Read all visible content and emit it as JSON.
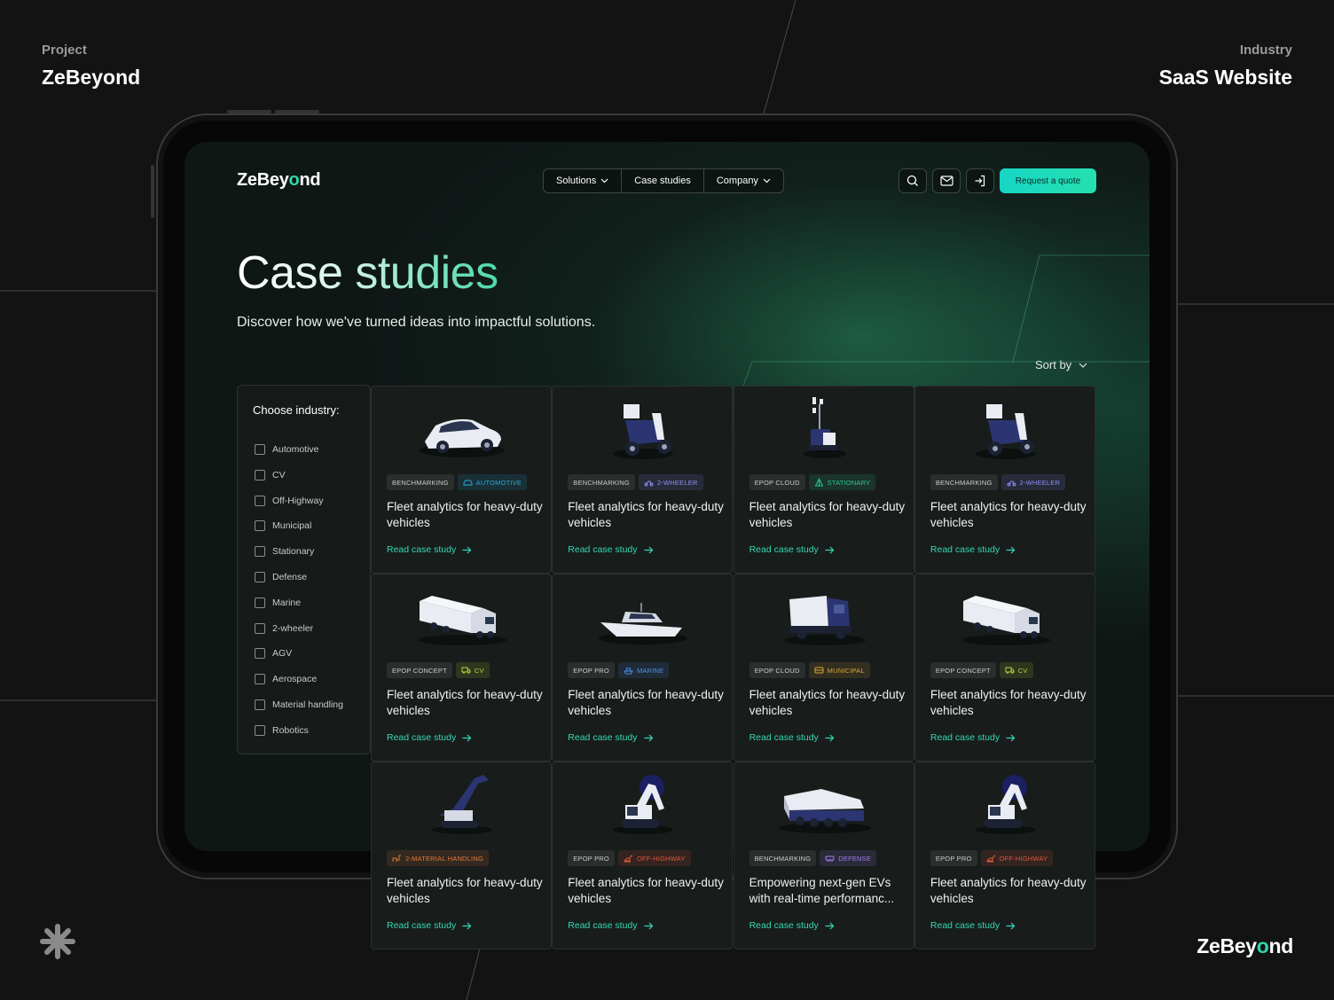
{
  "presentation": {
    "project_label": "Project",
    "project_name": "ZeBeyond",
    "industry_label": "Industry",
    "industry_name": "SaaS Website",
    "footer_logo_prefix": "ZeBey",
    "footer_logo_o": "o",
    "footer_logo_suffix": "nd"
  },
  "header": {
    "logo_prefix": "ZeBey",
    "logo_o": "o",
    "logo_suffix": "nd",
    "nav": [
      {
        "label": "Solutions",
        "dropdown": true
      },
      {
        "label": "Case studies",
        "dropdown": false
      },
      {
        "label": "Company",
        "dropdown": true
      }
    ],
    "icons": [
      "search-icon",
      "mail-icon",
      "login-icon"
    ],
    "cta_label": "Request a quote",
    "accent": "#1fdcc0"
  },
  "hero": {
    "title": "Case studies",
    "subtitle": "Discover how we've turned ideas into impactful solutions."
  },
  "sort": {
    "label": "Sort by"
  },
  "filters": {
    "title": "Choose industry:",
    "options": [
      "Automotive",
      "CV",
      "Off-Highway",
      "Municipal",
      "Stationary",
      "Defense",
      "Marine",
      "2-wheeler",
      "AGV",
      "Aerospace",
      "Material handling",
      "Robotics"
    ]
  },
  "cards": [
    {
      "image": "car",
      "tags": [
        {
          "label": "Benchmarking",
          "kind": "main"
        },
        {
          "label": "Automotive",
          "kind": "automotive",
          "color": "#2aa8d8"
        }
      ],
      "title": "Fleet analytics for heavy-duty vehicles",
      "link": "Read case study"
    },
    {
      "image": "scooter",
      "tags": [
        {
          "label": "Benchmarking",
          "kind": "main"
        },
        {
          "label": "2-wheeler",
          "kind": "twowheeler",
          "color": "#8d8ff0"
        }
      ],
      "title": "Fleet analytics for heavy-duty vehicles",
      "link": "Read case study"
    },
    {
      "image": "stationary",
      "tags": [
        {
          "label": "EPOP Cloud",
          "kind": "main"
        },
        {
          "label": "Stationary",
          "kind": "stationary",
          "color": "#2fc98c"
        }
      ],
      "title": "Fleet analytics for heavy-duty vehicles",
      "link": "Read case study"
    },
    {
      "image": "scooter",
      "tags": [
        {
          "label": "Benchmarking",
          "kind": "main"
        },
        {
          "label": "2-wheeler",
          "kind": "twowheeler",
          "color": "#8d8ff0"
        }
      ],
      "title": "Fleet analytics for heavy-duty vehicles",
      "link": "Read case study"
    },
    {
      "image": "truck",
      "tags": [
        {
          "label": "EPOP Concept",
          "kind": "main"
        },
        {
          "label": "CV",
          "kind": "cv",
          "color": "#b8d63a"
        }
      ],
      "title": "Fleet analytics for heavy-duty vehicles",
      "link": "Read case study"
    },
    {
      "image": "boat",
      "tags": [
        {
          "label": "EPOP Pro",
          "kind": "main"
        },
        {
          "label": "Marine",
          "kind": "marine",
          "color": "#4d8fe6"
        }
      ],
      "title": "Fleet analytics for heavy-duty vehicles",
      "link": "Read case study"
    },
    {
      "image": "municipal",
      "tags": [
        {
          "label": "EPOP Cloud",
          "kind": "main"
        },
        {
          "label": "Municipal",
          "kind": "municipal",
          "color": "#d9a63a"
        }
      ],
      "title": "Fleet analytics for heavy-duty vehicles",
      "link": "Read case study"
    },
    {
      "image": "truck",
      "tags": [
        {
          "label": "EPOP Concept",
          "kind": "main"
        },
        {
          "label": "CV",
          "kind": "cv",
          "color": "#b8d63a"
        }
      ],
      "title": "Fleet analytics for heavy-duty vehicles",
      "link": "Read case study"
    },
    {
      "image": "handler",
      "tags": [
        {
          "label": "2-Material handling",
          "kind": "material",
          "color": "#e07a3a"
        }
      ],
      "title": "Fleet analytics for heavy-duty vehicles",
      "link": "Read case study"
    },
    {
      "image": "excavator",
      "tags": [
        {
          "label": "EPOP Pro",
          "kind": "main"
        },
        {
          "label": "Off-Highway",
          "kind": "offhighway",
          "color": "#e0573a"
        }
      ],
      "title": "Fleet analytics for heavy-duty vehicles",
      "link": "Read case study"
    },
    {
      "image": "tank",
      "tags": [
        {
          "label": "Benchmarking",
          "kind": "main"
        },
        {
          "label": "Defense",
          "kind": "defense",
          "color": "#a07ef0"
        }
      ],
      "title": "Empowering next-gen EVs with real-time performanc...",
      "link": "Read case study"
    },
    {
      "image": "excavator",
      "tags": [
        {
          "label": "EPOP Pro",
          "kind": "main"
        },
        {
          "label": "Off-Highway",
          "kind": "offhighway",
          "color": "#e0573a"
        }
      ],
      "title": "Fleet analytics for heavy-duty vehicles",
      "link": "Read case study"
    }
  ]
}
